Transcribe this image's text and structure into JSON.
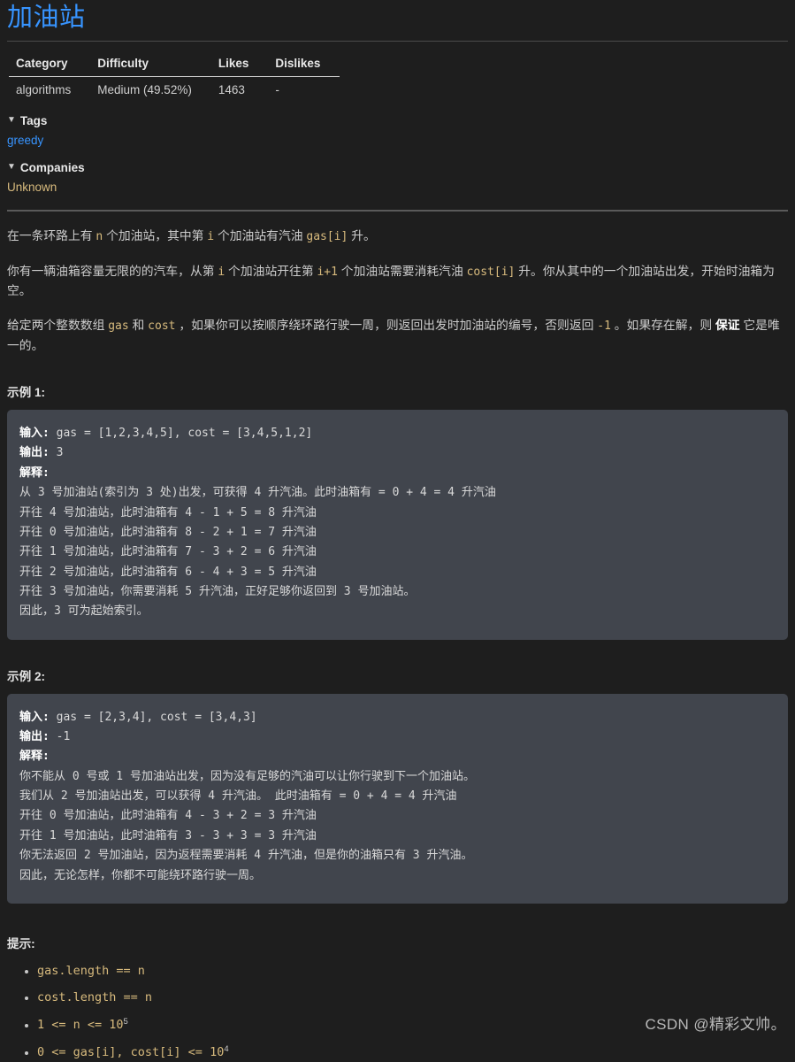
{
  "page": {
    "title": "加油站"
  },
  "meta_table": {
    "headers": [
      "Category",
      "Difficulty",
      "Likes",
      "Dislikes"
    ],
    "rows": [
      [
        "algorithms",
        "Medium (49.52%)",
        "1463",
        "-"
      ]
    ]
  },
  "sections": {
    "tags": {
      "caret": "▼",
      "label": "Tags",
      "value": "greedy"
    },
    "companies": {
      "caret": "▼",
      "label": "Companies",
      "value": "Unknown"
    }
  },
  "description": {
    "p1": {
      "t1": "在一条环路上有 ",
      "c1": "n",
      "t2": " 个加油站，其中第 ",
      "c2": "i",
      "t3": " 个加油站有汽油 ",
      "c3": "gas[i]",
      "t4": " 升。"
    },
    "p2": {
      "t1": "你有一辆油箱容量无限的的汽车，从第 ",
      "c1": "i",
      "t2": " 个加油站开往第 ",
      "c2": "i+1",
      "t3": " 个加油站需要消耗汽油 ",
      "c3": "cost[i]",
      "t4": " 升。你从其中的一个加油站出发，开始时油箱为空。"
    },
    "p3": {
      "t1": "给定两个整数数组 ",
      "c1": "gas",
      "t2": " 和 ",
      "c2": "cost",
      "t3": " ，如果你可以按顺序绕环路行驶一周，则返回出发时加油站的编号，否则返回 ",
      "c3": "-1",
      "t4": " 。如果存在解，则 ",
      "strong": "保证",
      "t5": " 它是唯一的。"
    }
  },
  "examples": [
    {
      "label": "示例 1:",
      "input_label": "输入:",
      "input_value": " gas = [1,2,3,4,5], cost = [3,4,5,1,2]",
      "output_label": "输出:",
      "output_value": " 3",
      "explain_label": "解释:",
      "explain_lines": [
        "从 3 号加油站(索引为 3 处)出发，可获得 4 升汽油。此时油箱有 = 0 + 4 = 4 升汽油",
        "开往 4 号加油站，此时油箱有 4 - 1 + 5 = 8 升汽油",
        "开往 0 号加油站，此时油箱有 8 - 2 + 1 = 7 升汽油",
        "开往 1 号加油站，此时油箱有 7 - 3 + 2 = 6 升汽油",
        "开往 2 号加油站，此时油箱有 6 - 4 + 3 = 5 升汽油",
        "开往 3 号加油站，你需要消耗 5 升汽油，正好足够你返回到 3 号加油站。",
        "因此，3 可为起始索引。"
      ]
    },
    {
      "label": "示例 2:",
      "input_label": "输入:",
      "input_value": " gas = [2,3,4], cost = [3,4,3]",
      "output_label": "输出:",
      "output_value": " -1",
      "explain_label": "解释:",
      "explain_lines": [
        "你不能从 0 号或 1 号加油站出发，因为没有足够的汽油可以让你行驶到下一个加油站。",
        "我们从 2 号加油站出发，可以获得 4 升汽油。 此时油箱有 = 0 + 4 = 4 升汽油",
        "开往 0 号加油站，此时油箱有 4 - 3 + 2 = 3 升汽油",
        "开往 1 号加油站，此时油箱有 3 - 3 + 3 = 3 升汽油",
        "你无法返回 2 号加油站，因为返程需要消耗 4 升汽油，但是你的油箱只有 3 升汽油。",
        "因此，无论怎样，你都不可能绕环路行驶一周。"
      ]
    }
  ],
  "hints": {
    "label": "提示:",
    "items": [
      {
        "text": "gas.length == n",
        "exp": ""
      },
      {
        "text": "cost.length == n",
        "exp": ""
      },
      {
        "text": "1 <= n <= 10",
        "exp": "5"
      },
      {
        "text": "0 <= gas[i], cost[i] <= 10",
        "exp": "4"
      }
    ]
  },
  "watermark": "CSDN @精彩文帅。",
  "colors": {
    "background": "#1e1e1e",
    "title": "#3794ff",
    "link": "#3794ff",
    "inline_code": "#d7ba7d",
    "code_block_bg": "#41454d",
    "text": "#cccccc"
  }
}
